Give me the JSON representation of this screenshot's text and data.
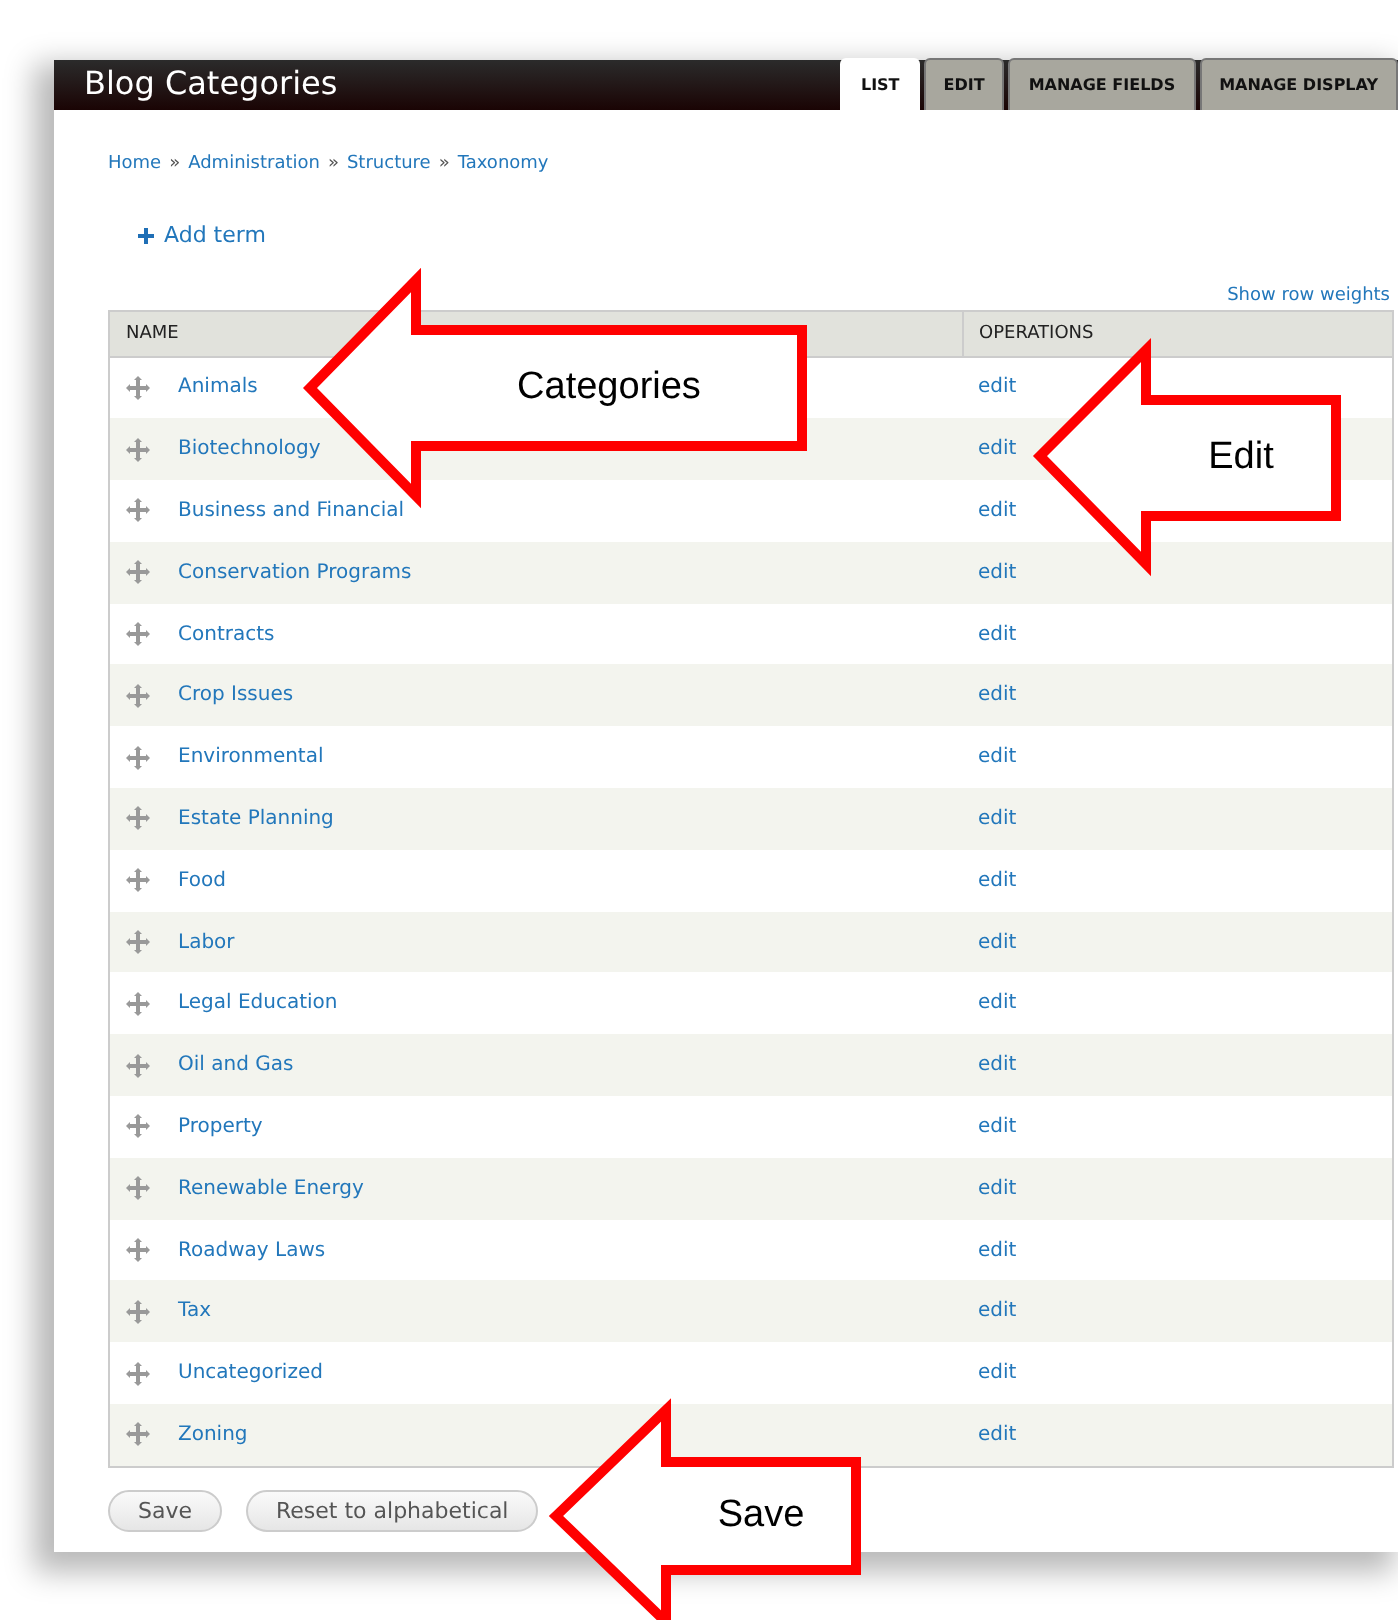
{
  "header": {
    "title": "Blog Categories"
  },
  "tabs": [
    {
      "label": "LIST",
      "selected": true
    },
    {
      "label": "EDIT",
      "selected": false
    },
    {
      "label": "MANAGE FIELDS",
      "selected": false
    },
    {
      "label": "MANAGE DISPLAY",
      "selected": false
    }
  ],
  "breadcrumb": [
    "Home",
    "Administration",
    "Structure",
    "Taxonomy"
  ],
  "breadcrumb_separator": "»",
  "add_term": "Add term",
  "show_row_weights": "Show row weights",
  "table": {
    "columns": [
      "NAME",
      "OPERATIONS"
    ],
    "rows": [
      {
        "name": "Animals",
        "operation": "edit"
      },
      {
        "name": "Biotechnology",
        "operation": "edit"
      },
      {
        "name": "Business and Financial",
        "operation": "edit"
      },
      {
        "name": "Conservation Programs",
        "operation": "edit"
      },
      {
        "name": "Contracts",
        "operation": "edit"
      },
      {
        "name": "Crop Issues",
        "operation": "edit"
      },
      {
        "name": "Environmental",
        "operation": "edit"
      },
      {
        "name": "Estate Planning",
        "operation": "edit"
      },
      {
        "name": "Food",
        "operation": "edit"
      },
      {
        "name": "Labor",
        "operation": "edit"
      },
      {
        "name": "Legal Education",
        "operation": "edit"
      },
      {
        "name": "Oil and Gas",
        "operation": "edit"
      },
      {
        "name": "Property",
        "operation": "edit"
      },
      {
        "name": "Renewable Energy",
        "operation": "edit"
      },
      {
        "name": "Roadway Laws",
        "operation": "edit"
      },
      {
        "name": "Tax",
        "operation": "edit"
      },
      {
        "name": "Uncategorized",
        "operation": "edit"
      },
      {
        "name": "Zoning",
        "operation": "edit"
      }
    ]
  },
  "buttons": [
    "Save",
    "Reset to alphabetical"
  ],
  "callouts": [
    {
      "label": "Categories"
    },
    {
      "label": "Edit"
    },
    {
      "label": "Save"
    }
  ]
}
